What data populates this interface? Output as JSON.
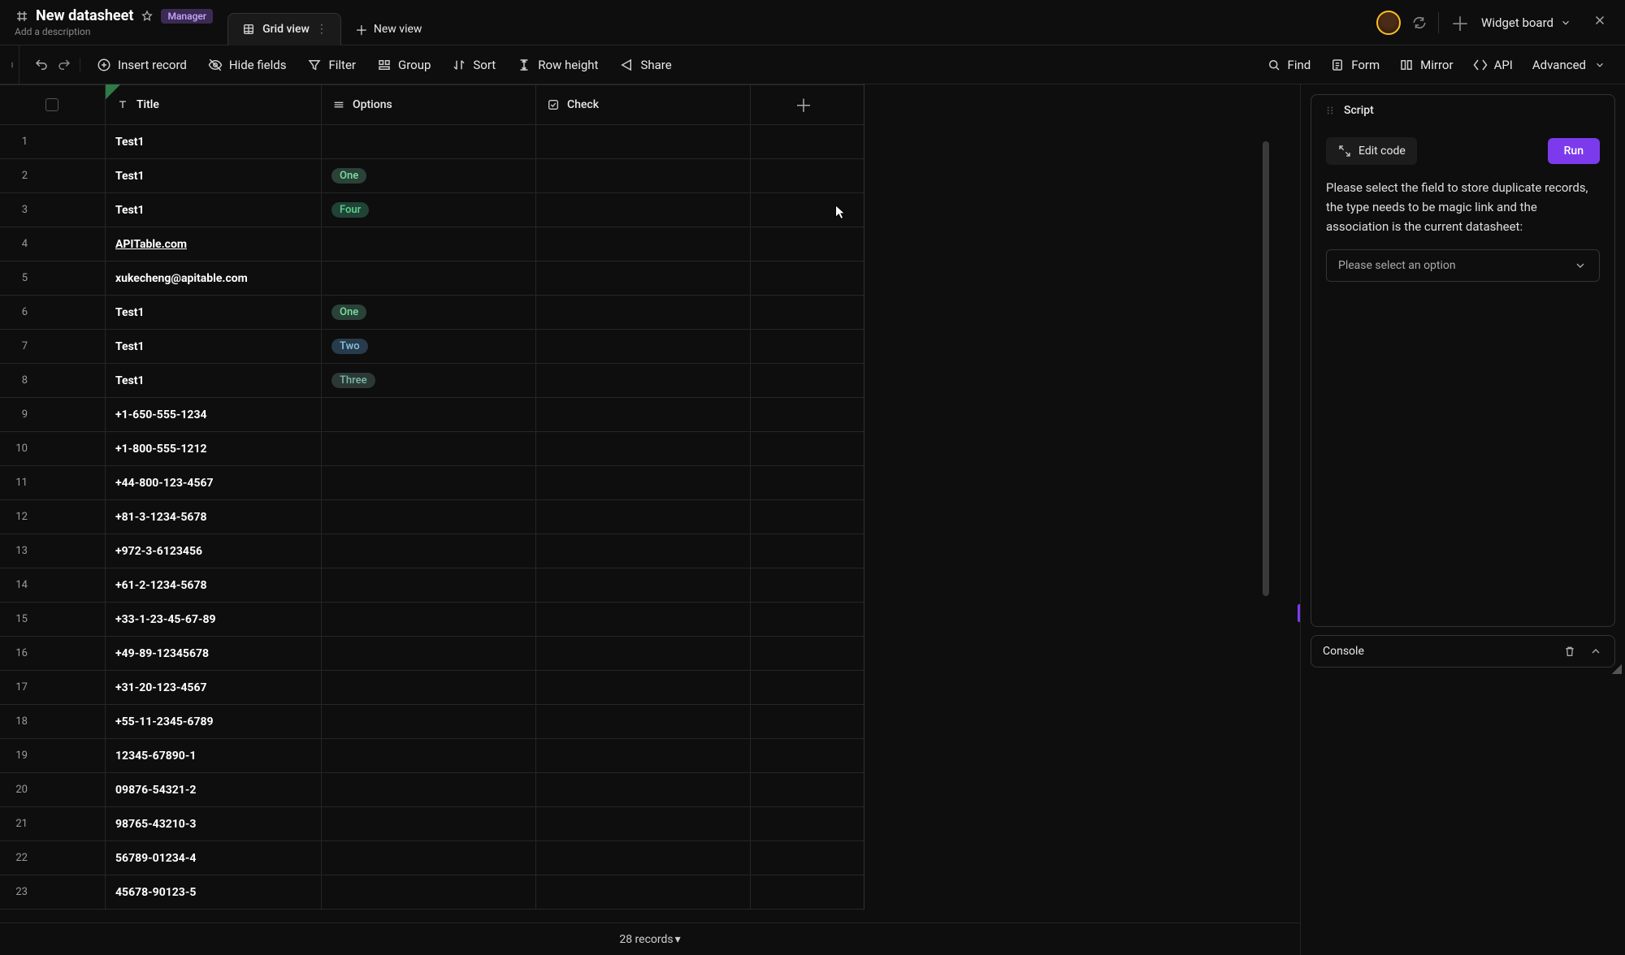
{
  "header": {
    "title": "New datasheet",
    "badge": "Manager",
    "description": "Add a description",
    "grid_view_label": "Grid view",
    "new_view_label": "New view",
    "widget_board_label": "Widget board"
  },
  "toolbar": {
    "insert_record": "Insert record",
    "hide_fields": "Hide fields",
    "filter": "Filter",
    "group": "Group",
    "sort": "Sort",
    "row_height": "Row height",
    "share": "Share",
    "find": "Find",
    "form": "Form",
    "mirror": "Mirror",
    "api": "API",
    "advanced": "Advanced"
  },
  "columns": {
    "title": "Title",
    "options": "Options",
    "check": "Check"
  },
  "options_pills": {
    "one": "One",
    "two": "Two",
    "three": "Three",
    "four": "Four"
  },
  "rows": [
    {
      "n": "1",
      "title": "Test1",
      "option": "",
      "link": false
    },
    {
      "n": "2",
      "title": "Test1",
      "option": "one",
      "link": false
    },
    {
      "n": "3",
      "title": "Test1",
      "option": "four",
      "link": false
    },
    {
      "n": "4",
      "title": "APITable.com",
      "option": "",
      "link": true
    },
    {
      "n": "5",
      "title": "xukecheng@apitable.com",
      "option": "",
      "link": false
    },
    {
      "n": "6",
      "title": "Test1",
      "option": "one",
      "link": false
    },
    {
      "n": "7",
      "title": "Test1",
      "option": "two",
      "link": false
    },
    {
      "n": "8",
      "title": "Test1",
      "option": "three",
      "link": false
    },
    {
      "n": "9",
      "title": "+1-650-555-1234",
      "option": "",
      "link": false
    },
    {
      "n": "10",
      "title": "+1-800-555-1212",
      "option": "",
      "link": false
    },
    {
      "n": "11",
      "title": "+44-800-123-4567",
      "option": "",
      "link": false
    },
    {
      "n": "12",
      "title": "+81-3-1234-5678",
      "option": "",
      "link": false
    },
    {
      "n": "13",
      "title": "+972-3-6123456",
      "option": "",
      "link": false
    },
    {
      "n": "14",
      "title": "+61-2-1234-5678",
      "option": "",
      "link": false
    },
    {
      "n": "15",
      "title": "+33-1-23-45-67-89",
      "option": "",
      "link": false
    },
    {
      "n": "16",
      "title": "+49-89-12345678",
      "option": "",
      "link": false
    },
    {
      "n": "17",
      "title": "+31-20-123-4567",
      "option": "",
      "link": false
    },
    {
      "n": "18",
      "title": "+55-11-2345-6789",
      "option": "",
      "link": false
    },
    {
      "n": "19",
      "title": "12345-67890-1",
      "option": "",
      "link": false
    },
    {
      "n": "20",
      "title": "09876-54321-2",
      "option": "",
      "link": false
    },
    {
      "n": "21",
      "title": "98765-43210-3",
      "option": "",
      "link": false
    },
    {
      "n": "22",
      "title": "56789-01234-4",
      "option": "",
      "link": false
    },
    {
      "n": "23",
      "title": "45678-90123-5",
      "option": "",
      "link": false
    }
  ],
  "status": {
    "records_label": "28 records"
  },
  "widget": {
    "title": "Script",
    "edit_code": "Edit code",
    "run": "Run",
    "description": "Please select the field to store duplicate records, the type needs to be magic link and the association is the current datasheet:",
    "select_placeholder": "Please select an option",
    "console_label": "Console"
  }
}
